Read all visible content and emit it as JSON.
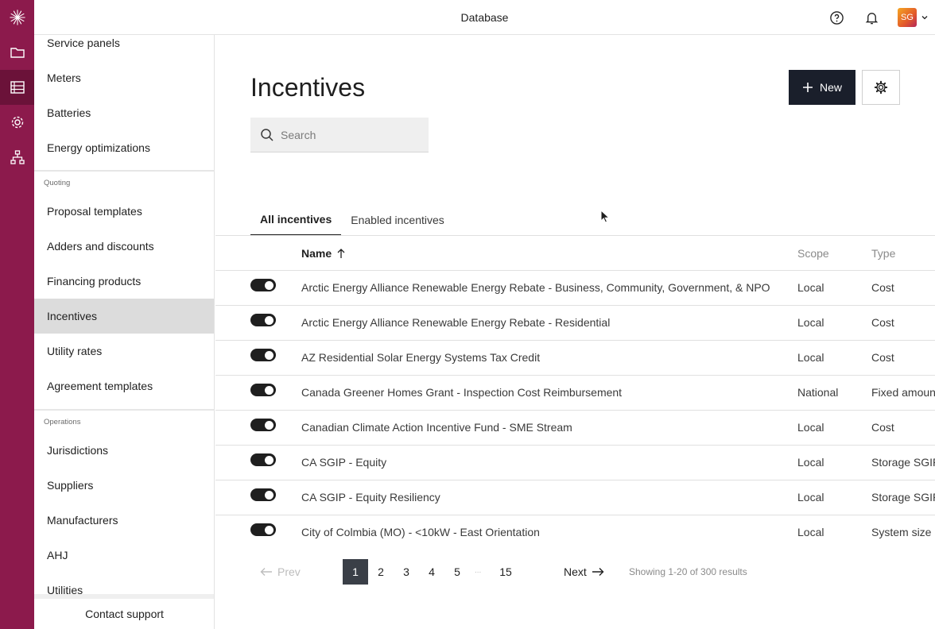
{
  "app": {
    "title": "Database",
    "avatar_initials": "SG",
    "brand_color": "#8c1a4c"
  },
  "rail": [
    {
      "icon": "sunburst-logo-icon"
    },
    {
      "icon": "folder-icon"
    },
    {
      "icon": "database-list-icon",
      "active": true
    },
    {
      "icon": "gear-icon"
    },
    {
      "icon": "org-chart-icon"
    }
  ],
  "sidebar": {
    "items_top": [
      {
        "label": "Service panels"
      },
      {
        "label": "Meters"
      },
      {
        "label": "Batteries"
      },
      {
        "label": "Energy optimizations"
      }
    ],
    "section_quoting": "Quoting",
    "items_quoting": [
      {
        "label": "Proposal templates"
      },
      {
        "label": "Adders and discounts"
      },
      {
        "label": "Financing products"
      },
      {
        "label": "Incentives",
        "active": true
      },
      {
        "label": "Utility rates"
      },
      {
        "label": "Agreement templates"
      }
    ],
    "section_operations": "Operations",
    "items_operations": [
      {
        "label": "Jurisdictions"
      },
      {
        "label": "Suppliers"
      },
      {
        "label": "Manufacturers"
      },
      {
        "label": "AHJ"
      },
      {
        "label": "Utilities"
      }
    ],
    "footer": "Contact support"
  },
  "main": {
    "title": "Incentives",
    "new_label": "New",
    "search_placeholder": "Search",
    "tabs": [
      {
        "label": "All incentives",
        "active": true
      },
      {
        "label": "Enabled incentives"
      }
    ],
    "columns": {
      "name": "Name",
      "scope": "Scope",
      "type": "Type"
    },
    "rows": [
      {
        "name": "Arctic Energy Alliance Renewable Energy Rebate - Business, Community, Government, & NPO",
        "scope": "Local",
        "type": "Cost",
        "enabled": true
      },
      {
        "name": "Arctic Energy Alliance Renewable Energy Rebate - Residential",
        "scope": "Local",
        "type": "Cost",
        "enabled": true
      },
      {
        "name": "AZ Residential Solar Energy Systems Tax Credit",
        "scope": "Local",
        "type": "Cost",
        "enabled": true
      },
      {
        "name": "Canada Greener Homes Grant - Inspection Cost Reimbursement",
        "scope": "National",
        "type": "Fixed amoun",
        "enabled": true
      },
      {
        "name": "Canadian Climate Action Incentive Fund - SME Stream",
        "scope": "Local",
        "type": "Cost",
        "enabled": true
      },
      {
        "name": "CA SGIP - Equity",
        "scope": "Local",
        "type": "Storage SGIP",
        "enabled": true
      },
      {
        "name": "CA SGIP - Equity Resiliency",
        "scope": "Local",
        "type": "Storage SGIP",
        "enabled": true
      },
      {
        "name": "City of Colmbia (MO) - <10kW - East Orientation",
        "scope": "Local",
        "type": "System size",
        "enabled": true
      }
    ],
    "pagination": {
      "prev": "Prev",
      "next": "Next",
      "pages": [
        "1",
        "2",
        "3",
        "4",
        "5",
        "15"
      ],
      "ellipsis": "...",
      "current": "1",
      "summary": "Showing 1-20 of 300 results"
    }
  }
}
